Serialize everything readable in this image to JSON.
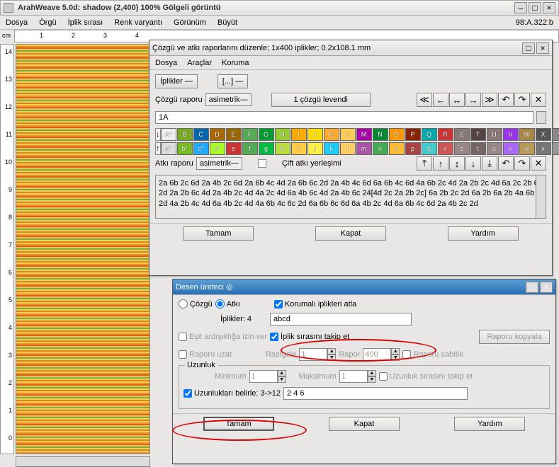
{
  "main": {
    "title": "ArahWeave 5.0d: shadow (2,400) 100% Gölgeli görüntü",
    "menu": [
      "Dosya",
      "Örgü",
      "İplik sırası",
      "Renk varyantı",
      "Görünüm",
      "Büyüt"
    ],
    "status": "98:A.322:b",
    "ruler_unit": "cm",
    "ruler_h": [
      "1",
      "2",
      "3",
      "4"
    ],
    "ruler_v": [
      "14",
      "13",
      "12",
      "11",
      "10",
      "9",
      "8",
      "7",
      "6",
      "5",
      "4",
      "3",
      "2",
      "1",
      "0"
    ]
  },
  "sub1": {
    "title": "Çözgü ve atkı raporlarını düzenle; 1x400 iplikler; 0.2x108.1 mm",
    "menu": [
      "Dosya",
      "Araçlar",
      "Koruma"
    ],
    "iplikler_label": "İplikler",
    "iplikler_dd": "—",
    "brackets_label": "[...]",
    "cozgu_label": "Çözgü raporu",
    "cozgu_mode": "asimetrik",
    "cozgu_levendi": "1 çözgü levendi",
    "cozgu_input": "1A",
    "letters_upper": [
      "A*",
      "B",
      "C",
      "D",
      "E",
      "F",
      "G",
      "H",
      "I",
      "J",
      "K",
      "L",
      "M",
      "N",
      "O",
      "P",
      "Q",
      "R",
      "S",
      "T",
      "U",
      "V",
      "W",
      "X",
      "Y"
    ],
    "letters_lower": [
      "a*",
      "b*",
      "c*",
      "d*",
      "e",
      "f",
      "g",
      "h",
      "i",
      "j",
      "k",
      "l",
      "m",
      "n",
      "o",
      "p",
      "q",
      "r",
      "s",
      "t",
      "u",
      "v",
      "w",
      "x",
      "y"
    ],
    "hash": "#",
    "colors_upper": [
      "#eee",
      "#7a2",
      "#06a",
      "#a60",
      "#960",
      "#5a5",
      "#093",
      "#9c3",
      "#fa0",
      "#fd0",
      "#fa3",
      "#fc5",
      "#a0a",
      "#083",
      "#f90",
      "#820",
      "#0aa",
      "#c33",
      "#877",
      "#544",
      "#877",
      "#93e",
      "#a84",
      "#555",
      "#888"
    ],
    "colors_lower": [
      "#ddd",
      "#7b2",
      "#2af",
      "#af2",
      "#c33",
      "#5a5",
      "#0b4",
      "#bd4",
      "#fc4",
      "#fe4",
      "#2cf",
      "#fc6",
      "#a5a",
      "#4a5",
      "#fb3",
      "#a44",
      "#4cc",
      "#c55",
      "#988",
      "#766",
      "#988",
      "#a6f",
      "#b95",
      "#777",
      "#999"
    ],
    "atki_label": "Atkı raporu",
    "atki_mode": "asimetrik",
    "cift_atki": "Çift atkı yerleşimi",
    "textpanel": "2a 6b 2c 6d 2a 4b 2c 6d 2a 6b 4c 4d 2a 6b 6c 2d 2a 4b 4c 6d 6a 6b 4c 6d 4a 6b 2c 4d 2a 2b 2c 4d 6a 2c 2b 6c 2d 2a 2b 6c 4d 2a 4b 2c 4d 4a 2c 4d 6a 4b 6c 4d 2a 4b 6c 24[4d 2c 2a 2b 2c] 6a 2b 2c 2d 6a 2b 6a 2b 4a 6b 2d 4a 2b 4c 4d 6a 4b 2c 4d 4a 6b 4c 6c 2d 6a 6b 6c 6d 6a 4b 2c 4d 6a 6b 4c 6d 2a 4b 2c 2d",
    "ok": "Tamam",
    "close": "Kapat",
    "help": "Yardım"
  },
  "sub2": {
    "title": "Desen üreteci",
    "cozgu": "Çözgü",
    "atki": "Atkı",
    "korumali": "Korumalı iplikleri atla",
    "iplikler_label": "İplikler: 4",
    "iplikler_value": "abcd",
    "esit": "Eşit ardışıklığa izin ver",
    "takip": "İplik sırasını takip et",
    "kopyala": "Raporu kopyala",
    "uzat": "Raporu uzat",
    "rastgele": "Rastgele",
    "rastgele_val": "1",
    "rapor": "Rapor",
    "rapor_val": "400",
    "sabitle": "Raporu sabitle",
    "uzunluk": "Uzunluk",
    "min": "Minimum",
    "min_val": "1",
    "max": "Maksimum",
    "max_val": "1",
    "uzunluk_takip": "Uzunluk sırasını takip et",
    "belirle": "Uzunlukları belirle: 3->12",
    "belirle_val": "2 4 6",
    "ok": "Tamam",
    "close": "Kapat",
    "help": "Yardım"
  }
}
